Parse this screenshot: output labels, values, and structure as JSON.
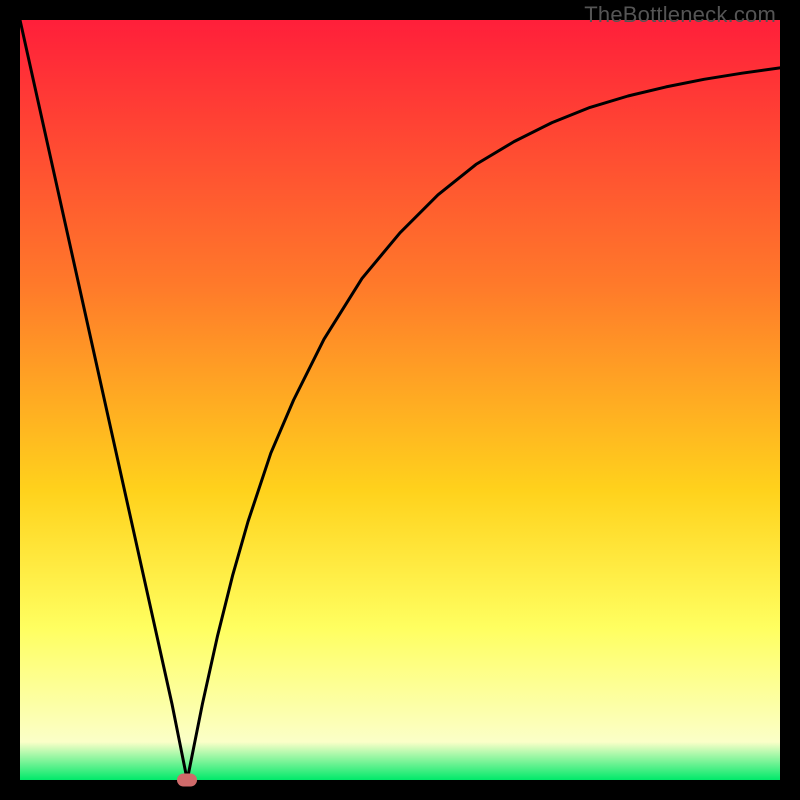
{
  "attribution": "TheBottleneck.com",
  "colors": {
    "gradient_top": "#ff1f3a",
    "gradient_mid_upper": "#ff7a2a",
    "gradient_mid": "#ffd21c",
    "gradient_lowband_top": "#ffff60",
    "gradient_lowband_bottom": "#fbffc8",
    "gradient_bottom": "#00e96a",
    "curve": "#000000",
    "marker": "#cf6a6a",
    "frame": "#000000"
  },
  "chart_data": {
    "type": "line",
    "title": "",
    "xlabel": "",
    "ylabel": "",
    "xlim": [
      0,
      100
    ],
    "ylim": [
      0,
      100
    ],
    "notch_x": 22,
    "series": [
      {
        "name": "bottleneck-curve",
        "x": [
          0,
          2,
          4,
          6,
          8,
          10,
          12,
          14,
          16,
          18,
          20,
          21,
          22,
          23,
          24,
          26,
          28,
          30,
          33,
          36,
          40,
          45,
          50,
          55,
          60,
          65,
          70,
          75,
          80,
          85,
          90,
          95,
          100
        ],
        "y": [
          100,
          91,
          82,
          73,
          64,
          55,
          46,
          37,
          28,
          19,
          10,
          5,
          0,
          5,
          10,
          19,
          27,
          34,
          43,
          50,
          58,
          66,
          72,
          77,
          81,
          84,
          86.5,
          88.5,
          90,
          91.2,
          92.2,
          93,
          93.7
        ]
      }
    ],
    "marker": {
      "x": 22,
      "y": 0
    },
    "legend": [],
    "grid": false
  }
}
